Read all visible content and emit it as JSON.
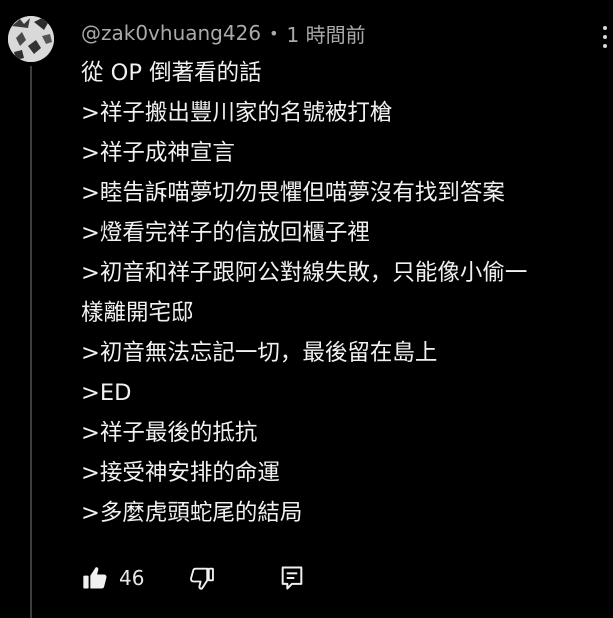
{
  "comment": {
    "author": "@zak0vhuang426",
    "separator": "•",
    "timestamp": "1 時間前",
    "lines": [
      "從 OP 倒著看的話",
      ">祥子搬出豐川家的名號被打槍",
      ">祥子成神宣言",
      ">睦告訴喵夢切勿畏懼但喵夢沒有找到答案",
      ">燈看完祥子的信放回櫃子裡",
      ">初音和祥子跟阿公對線失敗，只能像小偷一",
      "樣離開宅邸",
      ">初音無法忘記一切，最後留在島上",
      ">ED",
      ">祥子最後的抵抗",
      ">接受神安排的命運",
      ">多麼虎頭蛇尾的結局"
    ],
    "like_count": "46"
  },
  "icons": {
    "avatar": "avatar-image",
    "more": "more-vertical-icon",
    "like": "thumbs-up-icon",
    "dislike": "thumbs-down-icon",
    "reply": "reply-comment-icon"
  },
  "colors": {
    "background": "#000000",
    "text": "#f1f1f1",
    "meta": "#aaaaaa",
    "thread_line": "#3d3d3d"
  }
}
